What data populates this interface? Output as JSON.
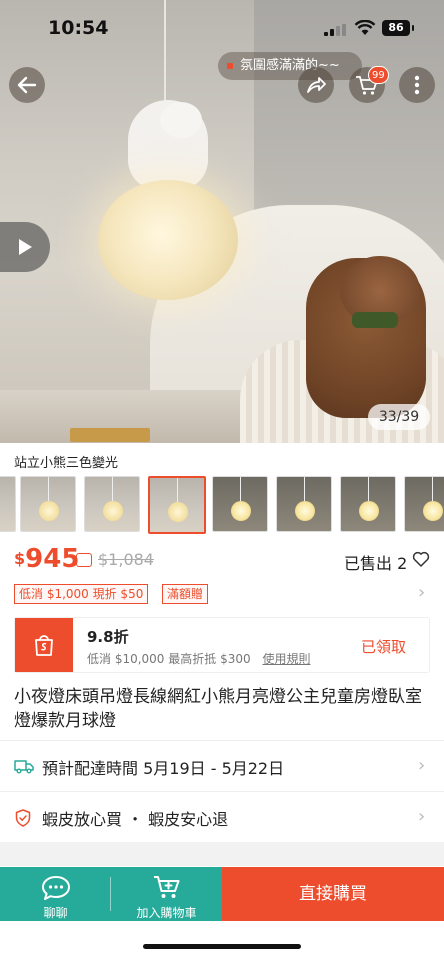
{
  "status_bar": {
    "time": "10:54",
    "battery": "86"
  },
  "top_nav": {
    "vibe_text": "氛圍感滿滿的~~",
    "cart_badge": "99"
  },
  "gallery": {
    "counter": "33/39"
  },
  "variant": {
    "title": "站立小熊三色變光",
    "thumbnails": [
      "thumb-1",
      "thumb-2",
      "thumb-3",
      "thumb-4",
      "thumb-5",
      "thumb-6",
      "thumb-7",
      "thumb-8"
    ],
    "selected_index": 3
  },
  "price": {
    "currency": "$",
    "current": "945",
    "original": "$1,084",
    "sold": "已售出 2"
  },
  "promos": [
    "低消 $1,000 現折 $50",
    "滿額贈"
  ],
  "voucher": {
    "discount": "9.8折",
    "description": "低消 $10,000 最高折抵 $300",
    "rule_link": "使用規則",
    "action": "已領取"
  },
  "product_title": "小夜燈床頭吊燈長線網紅小熊月亮燈公主兒童房燈臥室燈爆款月球燈",
  "shipping": {
    "label": "預計配達時間 5月19日 - 5月22日"
  },
  "guarantee": {
    "label": "蝦皮放心買 ・ 蝦皮安心退"
  },
  "bottom_bar": {
    "chat": "聊聊",
    "add_to_cart": "加入購物車",
    "buy_now": "直接購買"
  },
  "colors": {
    "brand": "#ee4d2d",
    "teal": "#26aa99"
  }
}
